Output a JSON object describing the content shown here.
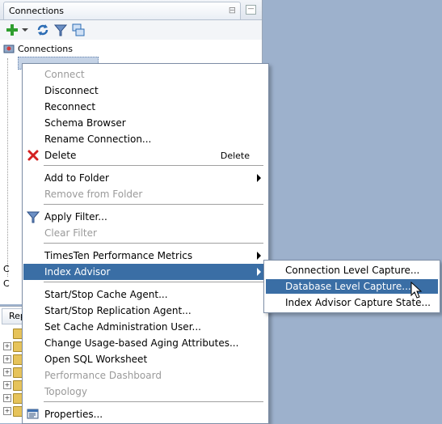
{
  "panel": {
    "tab_title": "Connections",
    "tab_close": "⊟",
    "minimize": "—",
    "tree_root": "Connections"
  },
  "reports": {
    "tab_label": "Rep"
  },
  "side_letters": [
    "C",
    "C"
  ],
  "menu": {
    "items": [
      {
        "label": "Connect",
        "disabled": true
      },
      {
        "label": "Disconnect"
      },
      {
        "label": "Reconnect"
      },
      {
        "label": "Schema Browser"
      },
      {
        "label": "Rename Connection..."
      },
      {
        "label": "Delete",
        "accel": "Delete",
        "icon": "red-x-icon"
      },
      {
        "label": "Add to Folder",
        "submenu": true
      },
      {
        "label": "Remove from Folder",
        "disabled": true
      },
      {
        "label": "Apply Filter...",
        "icon": "filter-icon"
      },
      {
        "label": "Clear Filter",
        "disabled": true
      },
      {
        "label": "TimesTen Performance Metrics",
        "submenu": true
      },
      {
        "label": "Index Advisor",
        "submenu": true,
        "selected": true
      },
      {
        "label": "Start/Stop Cache Agent..."
      },
      {
        "label": "Start/Stop Replication Agent..."
      },
      {
        "label": "Set Cache Administration User..."
      },
      {
        "label": "Change Usage-based Aging Attributes..."
      },
      {
        "label": "Open SQL Worksheet"
      },
      {
        "label": "Performance Dashboard",
        "disabled": true
      },
      {
        "label": "Topology",
        "disabled": true
      },
      {
        "label": "Properties...",
        "icon": "properties-icon"
      }
    ]
  },
  "submenu": {
    "items": [
      {
        "label": "Connection Level Capture..."
      },
      {
        "label": "Database Level Capture...",
        "selected": true
      },
      {
        "label": "Index Advisor Capture State..."
      }
    ]
  },
  "colors": {
    "selection": "#3a6ea5",
    "desktop": "#9db1cc",
    "disabled_text": "#9a9a9a"
  }
}
